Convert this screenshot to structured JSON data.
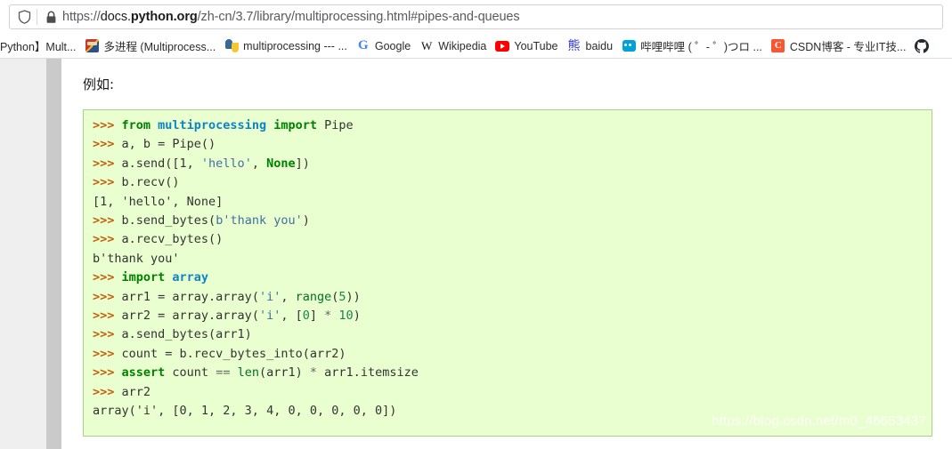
{
  "browser": {
    "shield_icon": "shield-icon",
    "lock_icon": "padlock-icon",
    "url": {
      "scheme": "https://",
      "host_prefix": "docs.",
      "host_strong": "python.org",
      "path": "/zh-cn/3.7/library/multiprocessing.html#pipes-and-queues",
      "full": "https://docs.python.org/zh-cn/3.7/library/multiprocessing.html#pipes-and-queues"
    }
  },
  "bookmarks": [
    {
      "label": "Python】Mult...",
      "icon": "none"
    },
    {
      "label": "多进程 (Multiprocess...",
      "icon": "multiprocess-favicon"
    },
    {
      "label": "multiprocessing --- ...",
      "icon": "python-favicon"
    },
    {
      "label": "Google",
      "icon": "google-favicon",
      "glyph": "G"
    },
    {
      "label": "Wikipedia",
      "icon": "wikipedia-favicon",
      "glyph": "W"
    },
    {
      "label": "YouTube",
      "icon": "youtube-favicon"
    },
    {
      "label": "baidu",
      "icon": "baidu-favicon",
      "glyph": "熊"
    },
    {
      "label": "哔哩哔哩 ( ゜- ゜)つロ ...",
      "icon": "bilibili-favicon"
    },
    {
      "label": "CSDN博客 - 专业IT技...",
      "icon": "csdn-favicon",
      "glyph": "C"
    },
    {
      "label": "",
      "icon": "github-favicon"
    }
  ],
  "content": {
    "heading": "例如:",
    "watermark": "https://blog.csdn.net/m0_46653437"
  },
  "code": {
    "language": "python-repl",
    "lines": [
      [
        {
          "t": ">>> ",
          "c": "prompt"
        },
        {
          "t": "from ",
          "c": "kw"
        },
        {
          "t": "multiprocessing ",
          "c": "kwmod"
        },
        {
          "t": "import ",
          "c": "kw"
        },
        {
          "t": "Pipe",
          "c": "plain"
        }
      ],
      [
        {
          "t": ">>> ",
          "c": "prompt"
        },
        {
          "t": "a, b = Pipe()",
          "c": "plain"
        }
      ],
      [
        {
          "t": ">>> ",
          "c": "prompt"
        },
        {
          "t": "a.send([1, ",
          "c": "plain"
        },
        {
          "t": "'hello'",
          "c": "str"
        },
        {
          "t": ", ",
          "c": "plain"
        },
        {
          "t": "None",
          "c": "kw"
        },
        {
          "t": "])",
          "c": "plain"
        }
      ],
      [
        {
          "t": ">>> ",
          "c": "prompt"
        },
        {
          "t": "b.recv()",
          "c": "plain"
        }
      ],
      [
        {
          "t": "[1, 'hello', None]",
          "c": "out"
        }
      ],
      [
        {
          "t": ">>> ",
          "c": "prompt"
        },
        {
          "t": "b.send_bytes(",
          "c": "plain"
        },
        {
          "t": "b'thank you'",
          "c": "str"
        },
        {
          "t": ")",
          "c": "plain"
        }
      ],
      [
        {
          "t": ">>> ",
          "c": "prompt"
        },
        {
          "t": "a.recv_bytes()",
          "c": "plain"
        }
      ],
      [
        {
          "t": "b'thank you'",
          "c": "out"
        }
      ],
      [
        {
          "t": ">>> ",
          "c": "prompt"
        },
        {
          "t": "import ",
          "c": "kw"
        },
        {
          "t": "array",
          "c": "kwmod"
        }
      ],
      [
        {
          "t": ">>> ",
          "c": "prompt"
        },
        {
          "t": "arr1 = array.array(",
          "c": "plain"
        },
        {
          "t": "'i'",
          "c": "str"
        },
        {
          "t": ", ",
          "c": "plain"
        },
        {
          "t": "range",
          "c": "builtin"
        },
        {
          "t": "(",
          "c": "plain"
        },
        {
          "t": "5",
          "c": "num"
        },
        {
          "t": "))",
          "c": "plain"
        }
      ],
      [
        {
          "t": ">>> ",
          "c": "prompt"
        },
        {
          "t": "arr2 = array.array(",
          "c": "plain"
        },
        {
          "t": "'i'",
          "c": "str"
        },
        {
          "t": ", [",
          "c": "plain"
        },
        {
          "t": "0",
          "c": "num"
        },
        {
          "t": "] ",
          "c": "plain"
        },
        {
          "t": "*",
          "c": "op"
        },
        {
          "t": " ",
          "c": "plain"
        },
        {
          "t": "10",
          "c": "num"
        },
        {
          "t": ")",
          "c": "plain"
        }
      ],
      [
        {
          "t": ">>> ",
          "c": "prompt"
        },
        {
          "t": "a.send_bytes(arr1)",
          "c": "plain"
        }
      ],
      [
        {
          "t": ">>> ",
          "c": "prompt"
        },
        {
          "t": "count = b.recv_bytes_into(arr2)",
          "c": "plain"
        }
      ],
      [
        {
          "t": ">>> ",
          "c": "prompt"
        },
        {
          "t": "assert ",
          "c": "kw"
        },
        {
          "t": "count ",
          "c": "plain"
        },
        {
          "t": "==",
          "c": "op"
        },
        {
          "t": " ",
          "c": "plain"
        },
        {
          "t": "len",
          "c": "builtin"
        },
        {
          "t": "(arr1) ",
          "c": "plain"
        },
        {
          "t": "*",
          "c": "op"
        },
        {
          "t": " arr1.itemsize",
          "c": "plain"
        }
      ],
      [
        {
          "t": ">>> ",
          "c": "prompt"
        },
        {
          "t": "arr2",
          "c": "plain"
        }
      ],
      [
        {
          "t": "array('i', [0, 1, 2, 3, 4, 0, 0, 0, 0, 0])",
          "c": "out"
        }
      ]
    ]
  }
}
